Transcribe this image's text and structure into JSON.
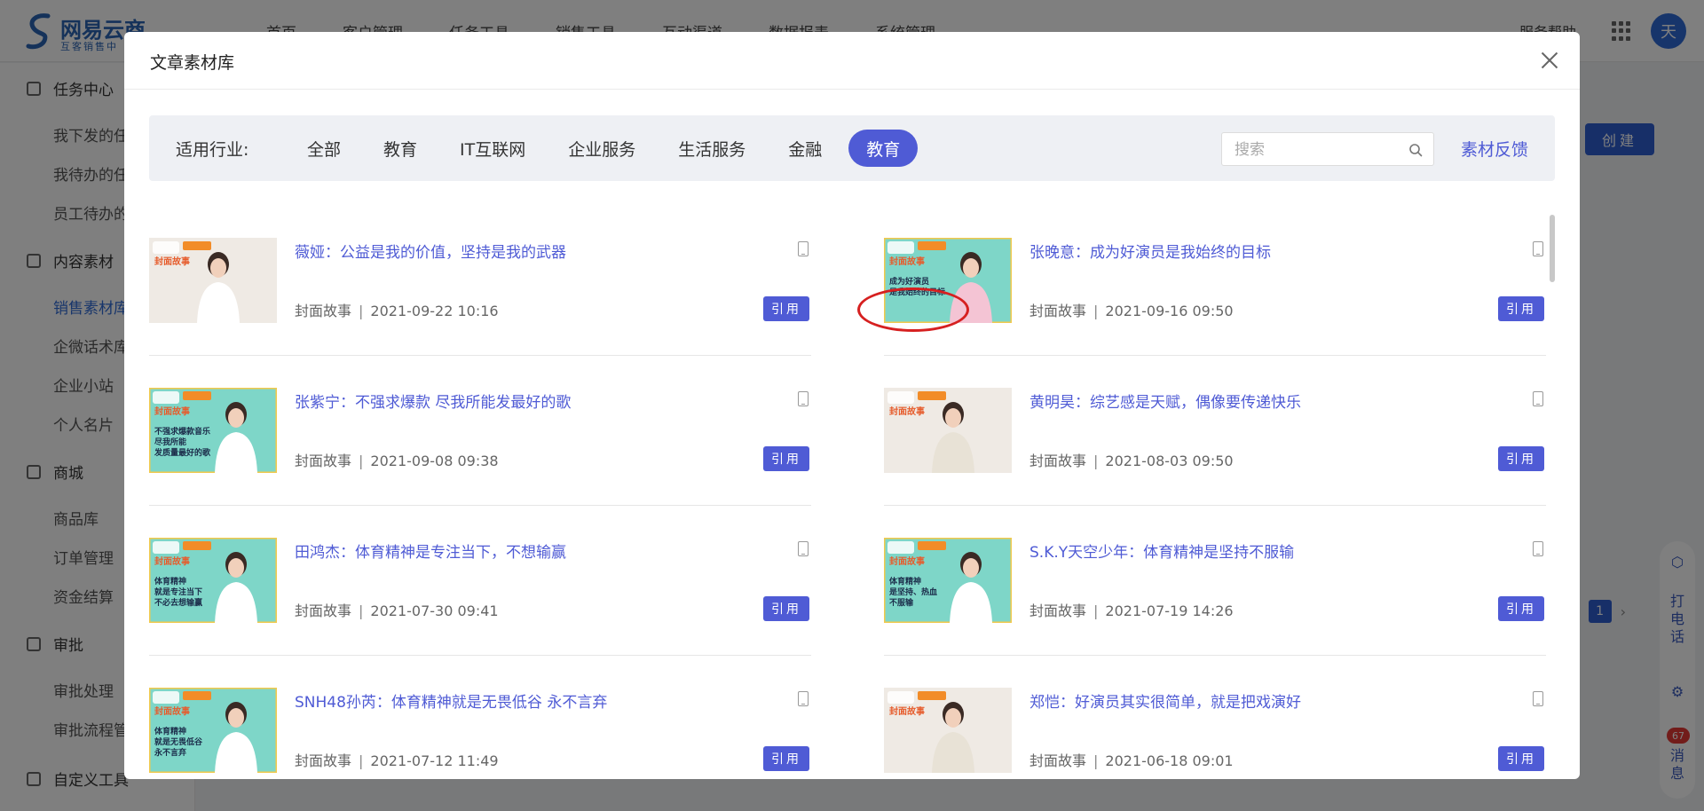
{
  "app": {
    "logo_title": "网易云商",
    "logo_subtitle": "互客销售中",
    "top_nav": [
      "首页",
      "客户管理",
      "任务工具",
      "销售工具",
      "互动渠道",
      "数据报表",
      "系统管理"
    ],
    "top_right_link": "服务帮助",
    "avatar_text": "天",
    "sidebar": {
      "groups": [
        {
          "label": "任务中心",
          "items": [
            "我下发的任务",
            "我待办的任务",
            "员工待办的任务"
          ]
        },
        {
          "label": "内容素材",
          "items": [
            "销售素材库",
            "企微话术库",
            "企业小站",
            "个人名片"
          ]
        },
        {
          "label": "商城",
          "items": [
            "商品库",
            "订单管理",
            "资金结算"
          ]
        },
        {
          "label": "审批",
          "items": [
            "审批处理",
            "审批流程管理"
          ]
        },
        {
          "label": "自定义工具",
          "items": []
        }
      ]
    },
    "create_button": "创建",
    "pager_page": "1",
    "float_bar": {
      "call": "打电话",
      "msg": "消息",
      "badge": "67"
    }
  },
  "modal": {
    "title": "文章素材库",
    "filter_label": "适用行业:",
    "chips": [
      "全部",
      "教育",
      "IT互联网",
      "企业服务",
      "生活服务",
      "金融",
      "教育"
    ],
    "active_chip_index": 6,
    "search_placeholder": "搜索",
    "feedback": "素材反馈",
    "cite_label": "引用",
    "meta_separator": "|",
    "articles": [
      {
        "title": "薇娅：公益是我的价值，坚持是我的武器",
        "category": "封面故事",
        "datetime": "2021-09-22 10:16",
        "highlighted": true
      },
      {
        "title": "张晚意：成为好演员是我始终的目标",
        "category": "封面故事",
        "datetime": "2021-09-16 09:50",
        "thumb_text": "成为好演员\n是我始终的目标"
      },
      {
        "title": "张紫宁：不强求爆款 尽我所能发最好的歌",
        "category": "封面故事",
        "datetime": "2021-09-08 09:38",
        "thumb_text": "不强求爆款音乐\n尽我所能\n发质量最好的歌"
      },
      {
        "title": "黄明昊：综艺感是天赋，偶像要传递快乐",
        "category": "封面故事",
        "datetime": "2021-08-03 09:50"
      },
      {
        "title": "田鸿杰：体育精神是专注当下，不想输赢",
        "category": "封面故事",
        "datetime": "2021-07-30 09:41",
        "thumb_text": "体育精神\n就是专注当下\n不必去想输赢"
      },
      {
        "title": "S.K.Y天空少年：体育精神是坚持不服输",
        "category": "封面故事",
        "datetime": "2021-07-19 14:26",
        "thumb_text": "体育精神\n是坚持、热血\n不服输"
      },
      {
        "title": "SNH48孙芮：体育精神就是无畏低谷 永不言弃",
        "category": "封面故事",
        "datetime": "2021-07-12 11:49",
        "thumb_text": "体育精神\n就是无畏低谷\n永不言弃"
      },
      {
        "title": "郑恺：好演员其实很简单，就是把戏演好",
        "category": "封面故事",
        "datetime": "2021-06-18 09:01"
      }
    ]
  },
  "colors": {
    "accent": "#4f5bd5",
    "highlight_ring": "#d62020",
    "thumb_teal": "#7ed6c8",
    "thumb_cream": "#f3efe8"
  }
}
